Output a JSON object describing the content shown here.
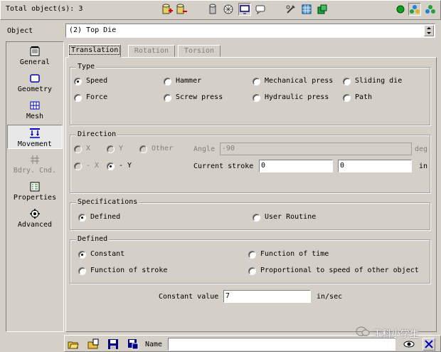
{
  "toolbar": {
    "total_objects": "Total object(s): 3"
  },
  "object_row": {
    "label": "Object",
    "value": "(2) Top Die"
  },
  "sidebar": {
    "items": [
      {
        "label": "General",
        "icon": "notepad-icon"
      },
      {
        "label": "Geometry",
        "icon": "geometry-icon"
      },
      {
        "label": "Mesh",
        "icon": "mesh-icon"
      },
      {
        "label": "Movement",
        "icon": "movement-icon"
      },
      {
        "label": "Bdry. Cnd.",
        "icon": "boundary-icon"
      },
      {
        "label": "Properties",
        "icon": "properties-icon"
      },
      {
        "label": "Advanced",
        "icon": "advanced-icon"
      }
    ]
  },
  "tabs": [
    {
      "label": "Translation"
    },
    {
      "label": "Rotation"
    },
    {
      "label": "Torsion"
    }
  ],
  "type_group": {
    "title": "Type",
    "options": [
      "Speed",
      "Hammer",
      "Mechanical press",
      "Sliding die",
      "Force",
      "Screw press",
      "Hydraulic press",
      "Path"
    ],
    "selected": "Speed"
  },
  "direction_group": {
    "title": "Direction",
    "x": "X",
    "y": "Y",
    "other": "Other",
    "neg_x": "- X",
    "neg_y": "- Y",
    "selected": "- Y",
    "angle_label": "Angle",
    "angle_value": "-90",
    "angle_unit": "deg",
    "stroke_label": "Current stroke",
    "stroke_value_1": "0",
    "stroke_value_2": "0",
    "stroke_unit": "in"
  },
  "spec_group": {
    "title": "Specifications",
    "defined": "Defined",
    "user_routine": "User Routine",
    "selected": "Defined"
  },
  "defined_group": {
    "title": "Defined",
    "constant": "Constant",
    "function_of_time": "Function of time",
    "function_of_stroke": "Function of stroke",
    "proportional": "Proportional to speed of other object",
    "selected": "Constant"
  },
  "constant_value": {
    "label": "Constant value",
    "value": "7",
    "unit": "in/sec"
  },
  "bottom_bar": {
    "name_label": "Name",
    "name_value": ""
  },
  "watermark": "王科小学生"
}
